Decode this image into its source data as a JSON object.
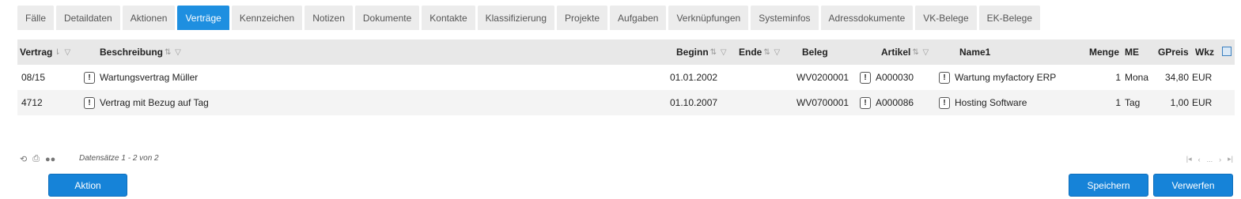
{
  "tabs": [
    {
      "label": "Fälle",
      "active": false
    },
    {
      "label": "Detaildaten",
      "active": false
    },
    {
      "label": "Aktionen",
      "active": false
    },
    {
      "label": "Verträge",
      "active": true
    },
    {
      "label": "Kennzeichen",
      "active": false
    },
    {
      "label": "Notizen",
      "active": false
    },
    {
      "label": "Dokumente",
      "active": false
    },
    {
      "label": "Kontakte",
      "active": false
    },
    {
      "label": "Klassifizierung",
      "active": false
    },
    {
      "label": "Projekte",
      "active": false
    },
    {
      "label": "Aufgaben",
      "active": false
    },
    {
      "label": "Verknüpfungen",
      "active": false
    },
    {
      "label": "Systeminfos",
      "active": false
    },
    {
      "label": "Adressdokumente",
      "active": false
    },
    {
      "label": "VK-Belege",
      "active": false
    },
    {
      "label": "EK-Belege",
      "active": false
    }
  ],
  "columns": {
    "vertrag": "Vertrag",
    "beschreibung": "Beschreibung",
    "beginn": "Beginn",
    "ende": "Ende",
    "beleg": "Beleg",
    "artikel": "Artikel",
    "name1": "Name1",
    "menge": "Menge",
    "me": "ME",
    "gpreis": "GPreis",
    "wkz": "Wkz"
  },
  "rows": [
    {
      "vertrag": "08/15",
      "beschreibung": "Wartungsvertrag Müller",
      "beginn": "01.01.2002",
      "ende": "",
      "beleg": "WV0200001",
      "artikel": "A000030",
      "name1": "Wartung myfactory ERP",
      "menge": "1",
      "me": "Mona",
      "gpreis": "34,80",
      "wkz": "EUR"
    },
    {
      "vertrag": "4712",
      "beschreibung": "Vertrag mit Bezug auf Tag",
      "beginn": "01.10.2007",
      "ende": "",
      "beleg": "WV0700001",
      "artikel": "A000086",
      "name1": "Hosting Software",
      "menge": "1",
      "me": "Tag",
      "gpreis": "1,00",
      "wkz": "EUR"
    }
  ],
  "footer": {
    "status": "Datensätze 1 - 2 von 2",
    "pager_ellipsis": "..."
  },
  "buttons": {
    "aktion": "Aktion",
    "speichern": "Speichern",
    "verwerfen": "Verwerfen"
  },
  "icons": {
    "info_badge": "!",
    "sort": "sort-icon",
    "filter": "filter-icon"
  },
  "colors": {
    "accent": "#1e8fe0",
    "button": "#1683d8",
    "header_bg": "#e8e8e8",
    "alt_row_bg": "#f4f4f4"
  }
}
